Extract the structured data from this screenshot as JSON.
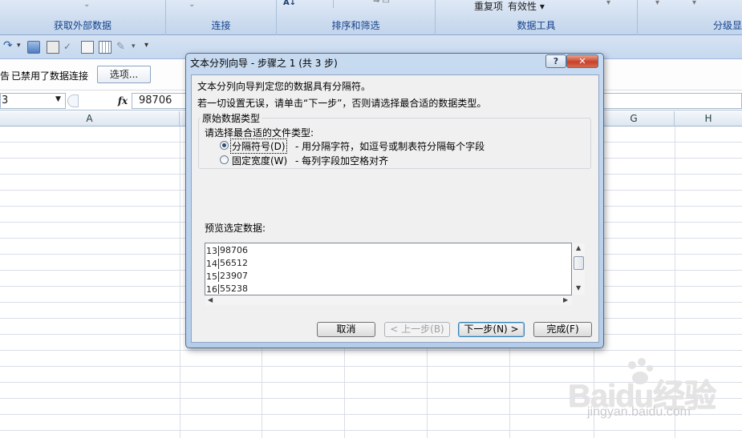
{
  "ribbon": {
    "groups": [
      {
        "label": "获取外部数据"
      },
      {
        "label": "连接"
      },
      {
        "label": "排序和筛选"
      },
      {
        "label": "数据工具"
      },
      {
        "label": "分级显"
      }
    ],
    "sort_hint": "A",
    "remove_duplicates": "重复项",
    "data_validation": "有效性",
    "data_validation_caret": "▾"
  },
  "qat": {
    "undo_caret": "▾",
    "customize_caret": "▾"
  },
  "message_bar": {
    "prefix": "告",
    "text": "已禁用了数据连接",
    "options_button": "选项..."
  },
  "formula_bar": {
    "name_box_value": "3",
    "name_box_caret": "▼",
    "fx_label": "fx",
    "value": "98706"
  },
  "grid": {
    "columns": [
      "A",
      "G",
      "H"
    ]
  },
  "dialog": {
    "title": "文本分列向导 - 步骤之 1 (共 3 步)",
    "help_label": "?",
    "close_label": "✕",
    "line1": "文本分列向导判定您的数据具有分隔符。",
    "line2": "若一切设置无误，请单击“下一步”，否则请选择最合适的数据类型。",
    "group_title": "原始数据类型",
    "group_prompt": "请选择最合适的文件类型:",
    "option_delimited": "分隔符号(D)",
    "option_delimited_desc": "- 用分隔字符，如逗号或制表符分隔每个字段",
    "option_fixed": "固定宽度(W)",
    "option_fixed_desc": "- 每列字段加空格对齐",
    "preview_label": "预览选定数据:",
    "preview_rows": [
      {
        "num": "13",
        "val": "98706"
      },
      {
        "num": "14",
        "val": "56512"
      },
      {
        "num": "15",
        "val": "23907"
      },
      {
        "num": "16",
        "val": "55238"
      }
    ],
    "buttons": {
      "cancel": "取消",
      "back": "< 上一步(B)",
      "next": "下一步(N) >",
      "finish": "完成(F)"
    }
  },
  "watermark": {
    "logo": "Baidu经验",
    "url": "jingyan.baidu.com"
  }
}
